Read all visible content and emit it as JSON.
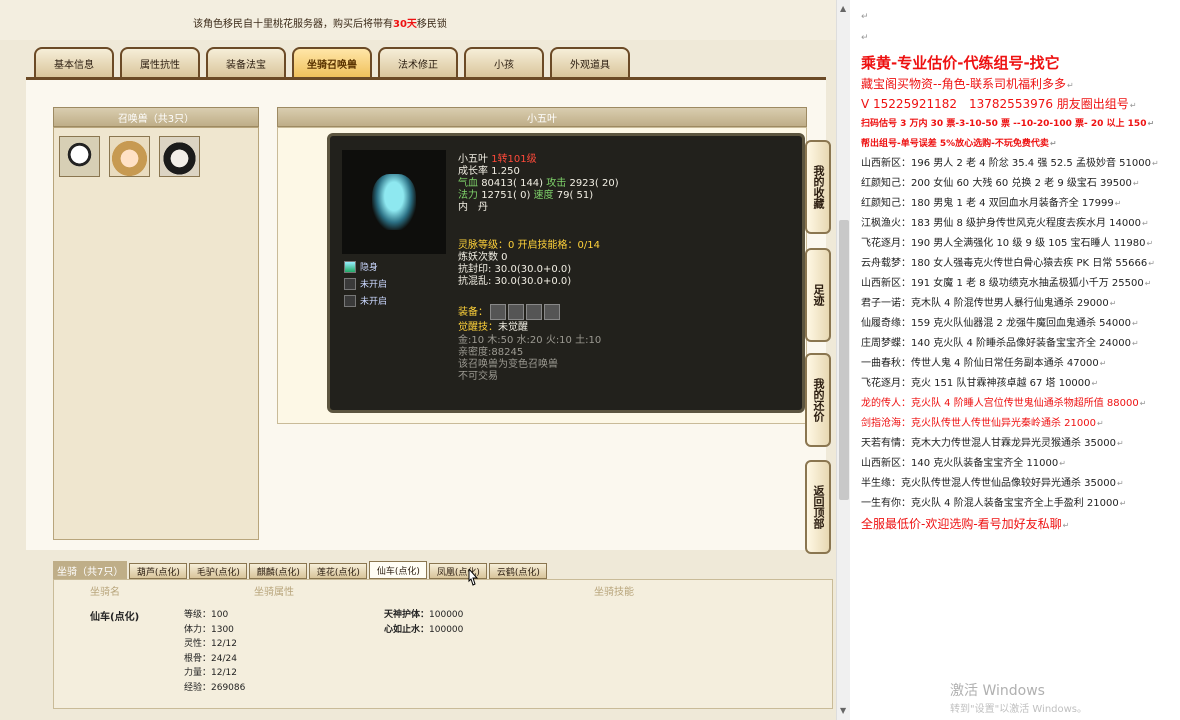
{
  "notice": {
    "prefix": "该角色移民自十里桃花服务器，购买后将带有",
    "highlight": "30天",
    "suffix": "移民锁"
  },
  "tabs": [
    "基本信息",
    "属性抗性",
    "装备法宝",
    "坐骑召唤兽",
    "法术修正",
    "小孩",
    "外观道具"
  ],
  "pet_list": {
    "title": "召唤兽（共3只）"
  },
  "pet_detail": {
    "title": "小五叶",
    "name": "小五叶",
    "rebirth": "1转101级",
    "growth": "成长率 1.250",
    "hp_line": {
      "label": "气血",
      "val": "80413( 144)",
      "label2": "攻击",
      "val2": "2923( 20)"
    },
    "mp_line": {
      "label": "法力",
      "val": "12751( 0)",
      "label2": "速度",
      "val2": "79( 51)"
    },
    "inner": "内　丹",
    "spirit": "灵脉等级：0 开启技能格：0/14",
    "refine": "炼妖次数 0",
    "seal": "抗封印: 30.0(30.0+0.0)",
    "chaos": "抗混乱: 30.0(30.0+0.0)",
    "equip_label": "装备：",
    "awaken": "觉醒技：",
    "awaken_val": "未觉醒",
    "elements": "金:10 木:50 水:20 火:10 土:10",
    "intimacy": "亲密度:88245",
    "variant": "该召唤兽为变色召唤兽",
    "untradeable": "不可交易",
    "skills": [
      "隐身",
      "未开启",
      "未开启"
    ]
  },
  "side_buttons": [
    "我的收藏",
    "足迹",
    "我的还价",
    "返回顶部"
  ],
  "mounts": {
    "title": "坐骑（共7只）",
    "tabs": [
      "葫芦(点化)",
      "毛驴(点化)",
      "麒麟(点化)",
      "莲花(点化)",
      "仙车(点化)",
      "凤凰(点化)",
      "云鹤(点化)"
    ],
    "active_tab": 4,
    "headers": [
      "坐骑名",
      "坐骑属性",
      "坐骑技能"
    ],
    "name": "仙车(点化)",
    "attrs": [
      "等级：100",
      "体力：1300",
      "灵性：12/12",
      "根骨：24/24",
      "力量：12/12",
      "经验：269086"
    ],
    "skills": [
      {
        "k": "天神护体：",
        "v": "100000"
      },
      {
        "k": "心如止水：",
        "v": "100000"
      }
    ]
  },
  "doc": {
    "heading": "乘黄-专业估价-代练组号-找它",
    "lines": [
      {
        "t": "藏宝阁买物资--角色-联系司机福利多多",
        "s": "redm"
      },
      {
        "t": "V 15225921182　13782553976 朋友圈出组号",
        "s": "redm"
      },
      {
        "t": "扫码估号 3 万内 30 票-3-10-50 票 --10-20-100 票- 20 以上 150",
        "s": "redb"
      },
      {
        "t": "帮出组号-单号误差 5%放心选购-不玩免费代卖",
        "s": "redb"
      },
      {
        "t": "山西新区：196 男人 2 老 4 阶忿 35.4 强 52.5 孟极妙音 51000",
        "s": ""
      },
      {
        "t": "红颜知己：200 女仙 60 大残 60 兑换 2 老 9 级宝石 39500",
        "s": ""
      },
      {
        "t": "红颜知己：180 男鬼 1 老 4 双回血水月装备齐全 17999",
        "s": ""
      },
      {
        "t": "江枫渔火：183 男仙 8 级护身传世风克火程度去疾水月 14000",
        "s": ""
      },
      {
        "t": "飞花逐月：190 男人全满强化 10 级 9 级 105 宝石睡人 11980",
        "s": ""
      },
      {
        "t": "云舟载梦：180 女人强毒克火传世白骨心猿去疾 PK 日常 55666",
        "s": ""
      },
      {
        "t": "山西新区：191 女魔 1 老 8 级功绩克水抽孟极狐小千万 25500",
        "s": ""
      },
      {
        "t": "君子一诺：克木队 4 阶混传世男人暴行仙鬼通杀 29000",
        "s": ""
      },
      {
        "t": "仙履奇缘：159 克火队仙器混 2 龙强牛魔回血鬼通杀 54000",
        "s": ""
      },
      {
        "t": "庄周梦蝶：140 克火队 4 阶睡杀品像好装备宝宝齐全 24000",
        "s": ""
      },
      {
        "t": "一曲春秋：传世人鬼 4 阶仙日常任务副本通杀 47000",
        "s": ""
      },
      {
        "t": "飞花逐月：克火 151 队甘霖神孩卓越 67 塔 10000",
        "s": ""
      },
      {
        "t": "龙的传人：克火队 4 阶睡人宫位传世鬼仙通杀物超所值 88000",
        "s": "red"
      },
      {
        "t": "剑指沧海：克火队传世人传世仙异光秦岭通杀 21000",
        "s": "red"
      },
      {
        "t": "天若有情：克木大力传世混人甘霖龙异光灵猴通杀 35000",
        "s": ""
      },
      {
        "t": "山西新区：140 克火队装备宝宝齐全 11000",
        "s": ""
      },
      {
        "t": "半生缘：克火队传世混人传世仙品像较好异光通杀 35000",
        "s": ""
      },
      {
        "t": "一生有你：克火队 4 阶混人装备宝宝齐全上手盈利 21000",
        "s": ""
      },
      {
        "t": "全服最低价-欢迎选购-看号加好友私聊",
        "s": "redm"
      }
    ]
  },
  "watermark": {
    "line1": "激活 Windows",
    "line2": "转到\"设置\"以激活 Windows。"
  }
}
